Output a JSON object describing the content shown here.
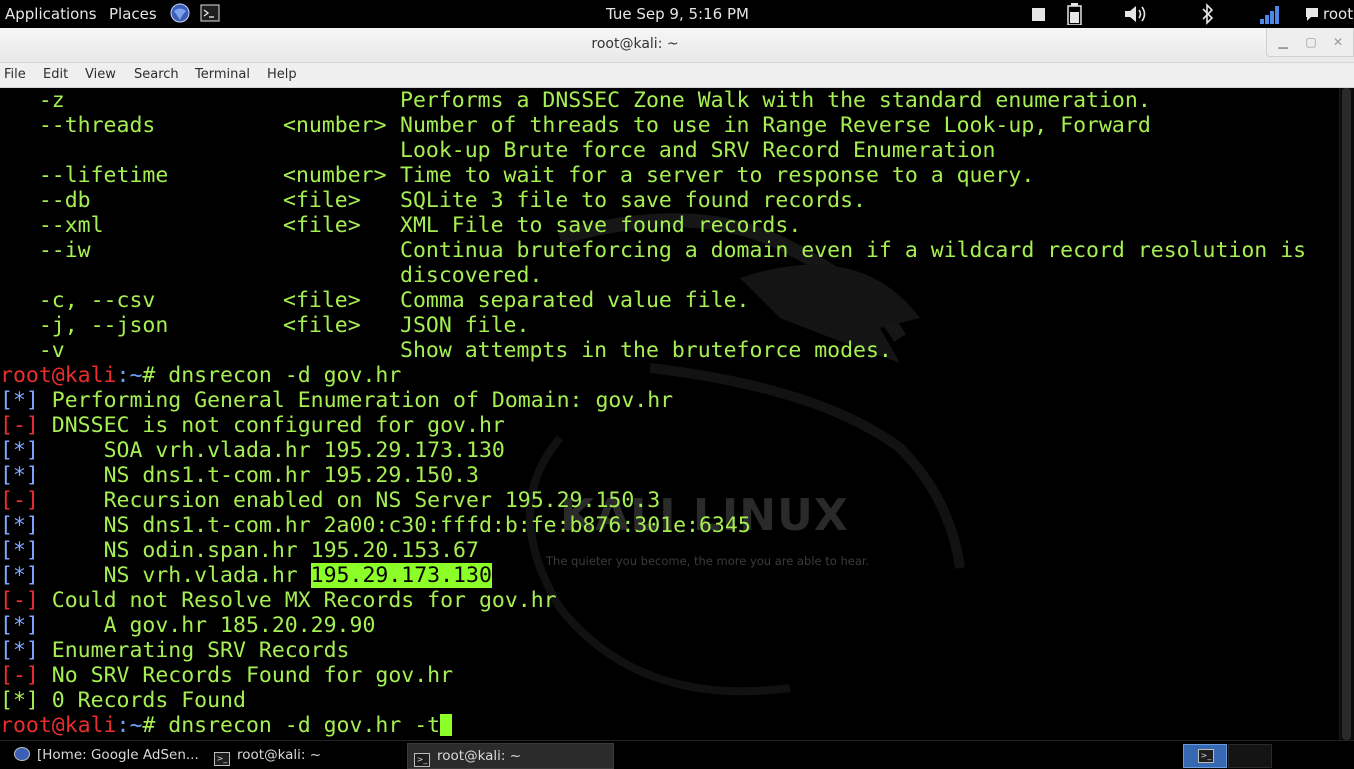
{
  "top_panel": {
    "applications": "Applications",
    "places": "Places",
    "datetime": "Tue Sep  9,  5:16 PM",
    "user": "root"
  },
  "window": {
    "title": "root@kali: ~",
    "menu": [
      "File",
      "Edit",
      "View",
      "Search",
      "Terminal",
      "Help"
    ]
  },
  "terminal": {
    "help_lines": [
      {
        "opt": "   -z",
        "arg": "",
        "desc": "Performs a DNSSEC Zone Walk with the standard enumeration."
      },
      {
        "opt": "   --threads",
        "arg": "<number>",
        "desc": "Number of threads to use in Range Reverse Look-up, Forward"
      },
      {
        "opt": "",
        "arg": "",
        "desc": "Look-up Brute force and SRV Record Enumeration"
      },
      {
        "opt": "   --lifetime",
        "arg": "<number>",
        "desc": "Time to wait for a server to response to a query."
      },
      {
        "opt": "   --db",
        "arg": "<file>",
        "desc": "SQLite 3 file to save found records."
      },
      {
        "opt": "   --xml",
        "arg": "<file>",
        "desc": "XML File to save found records."
      },
      {
        "opt": "   --iw",
        "arg": "",
        "desc": "Continua bruteforcing a domain even if a wildcard record resolution is"
      },
      {
        "opt": "",
        "arg": "",
        "desc": "discovered."
      },
      {
        "opt": "   -c, --csv",
        "arg": "<file>",
        "desc": "Comma separated value file."
      },
      {
        "opt": "   -j, --json",
        "arg": "<file>",
        "desc": "JSON file."
      },
      {
        "opt": "   -v",
        "arg": "",
        "desc": "Show attempts in the bruteforce modes."
      }
    ],
    "prompt_user": "root@kali",
    "prompt_path": ":~",
    "prompt_hash": "# ",
    "command_1": "dnsrecon -d gov.hr",
    "output": [
      {
        "marker": "[*]",
        "kind": "star",
        "text": " Performing General Enumeration of Domain: gov.hr"
      },
      {
        "marker": "[-]",
        "kind": "minus",
        "text": " DNSSEC is not configured for gov.hr"
      },
      {
        "marker": "[*]",
        "kind": "star",
        "text": " \t SOA vrh.vlada.hr 195.29.173.130"
      },
      {
        "marker": "[*]",
        "kind": "star",
        "text": " \t NS dns1.t-com.hr 195.29.150.3"
      },
      {
        "marker": "[-]",
        "kind": "minus",
        "text": " \t Recursion enabled on NS Server 195.29.150.3"
      },
      {
        "marker": "[*]",
        "kind": "star",
        "text": " \t NS dns1.t-com.hr 2a00:c30:fffd:b:fe:b876:301e:6345"
      },
      {
        "marker": "[*]",
        "kind": "star",
        "text": " \t NS odin.span.hr 195.20.153.67"
      },
      {
        "marker": "[*]",
        "kind": "star",
        "text": " \t NS vrh.vlada.hr ",
        "highlight": "195.29.173.130"
      },
      {
        "marker": "[-]",
        "kind": "minus",
        "text": " Could not Resolve MX Records for gov.hr"
      },
      {
        "marker": "[*]",
        "kind": "star",
        "text": " \t A gov.hr 185.20.29.90"
      },
      {
        "marker": "[*]",
        "kind": "star",
        "text": " Enumerating SRV Records"
      },
      {
        "marker": "[-]",
        "kind": "minus",
        "text": " No SRV Records Found for gov.hr"
      },
      {
        "marker": "[*]",
        "kind": "plain",
        "text": " 0 Records Found"
      }
    ],
    "command_2": "dnsrecon -d gov.hr -t",
    "watermark_title": "KALI LINUX",
    "watermark_tagline": "The quieter you become, the more you are able to hear."
  },
  "taskbar": {
    "tasks": [
      "[Home: Google AdSen...",
      "root@kali: ~",
      "root@kali: ~"
    ]
  },
  "colors": {
    "terminal_text": "#a6ef52",
    "prompt_user": "#ea2d2d",
    "prompt_path": "#6aa0ff",
    "highlight": "#8dff28"
  }
}
